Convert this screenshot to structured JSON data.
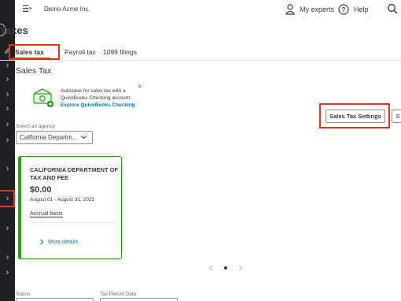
{
  "topbar": {
    "company_name": "Demo Acme Inc.",
    "experts_label": "My experts",
    "help_label": "Help"
  },
  "page": {
    "title": "Taxes"
  },
  "tabs": [
    {
      "label": "Sales tax",
      "active": true
    },
    {
      "label": "Payroll tax",
      "active": false
    },
    {
      "label": "1099 filings",
      "active": false
    }
  ],
  "section": {
    "title": "Sales Tax"
  },
  "promo": {
    "text": "Autosave for sales tax with a QuickBooks Checking account.",
    "link": "Explore QuickBooks Checking",
    "close_glyph": "×"
  },
  "actions": {
    "settings_label": "Sales Tax Settings",
    "partial_label": "E"
  },
  "agency": {
    "label": "Select an agency",
    "selected": "California Departm..."
  },
  "card": {
    "title": "CALIFORNIA DEPARTMENT OF TAX AND FEE",
    "amount": "$0.00",
    "period": "August 01 - August 31, 2023",
    "basis": "Accrual basis",
    "more_details": "More details"
  },
  "filters": {
    "status_label": "Status",
    "period_label": "Tax Period Date"
  },
  "sidebar": {
    "items": [
      "›",
      "›",
      "›",
      "›",
      "›",
      "›",
      "›",
      "›",
      "›",
      "›",
      "›"
    ]
  },
  "colors": {
    "accent_green": "#2ca01c",
    "link_blue": "#0077c5",
    "highlight_red": "#e8311c",
    "sidebar_bg": "#1f2023"
  }
}
